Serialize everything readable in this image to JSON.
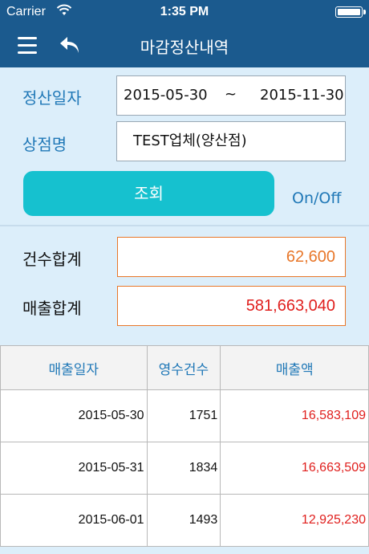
{
  "status_bar": {
    "carrier": "Carrier",
    "time": "1:35 PM"
  },
  "nav": {
    "title": "마감정산내역",
    "menu_icon": "hamburger-icon",
    "back_icon": "undo-arrow-icon"
  },
  "search": {
    "date_label": "정산일자",
    "date_from": "2015-05-30",
    "date_sep": "~",
    "date_to": "2015-11-30",
    "store_label": "상점명",
    "store_value": "TEST업체(양산점)",
    "search_button": "조회",
    "toggle_label": "On/Off"
  },
  "totals": {
    "count_label": "건수합계",
    "count_value": "62,600",
    "sales_label": "매출합계",
    "sales_value": "581,663,040"
  },
  "colors": {
    "count_color": "#e8772a",
    "sales_color": "#e0201e",
    "accent": "#16c1cf",
    "nav": "#1b5a8e"
  },
  "table": {
    "headers": [
      "매출일자",
      "영수건수",
      "매출액"
    ],
    "rows": [
      [
        "2015-05-30",
        "1751",
        "16,583,109"
      ],
      [
        "2015-05-31",
        "1834",
        "16,663,509"
      ],
      [
        "2015-06-01",
        "1493",
        "12,925,230"
      ]
    ]
  }
}
